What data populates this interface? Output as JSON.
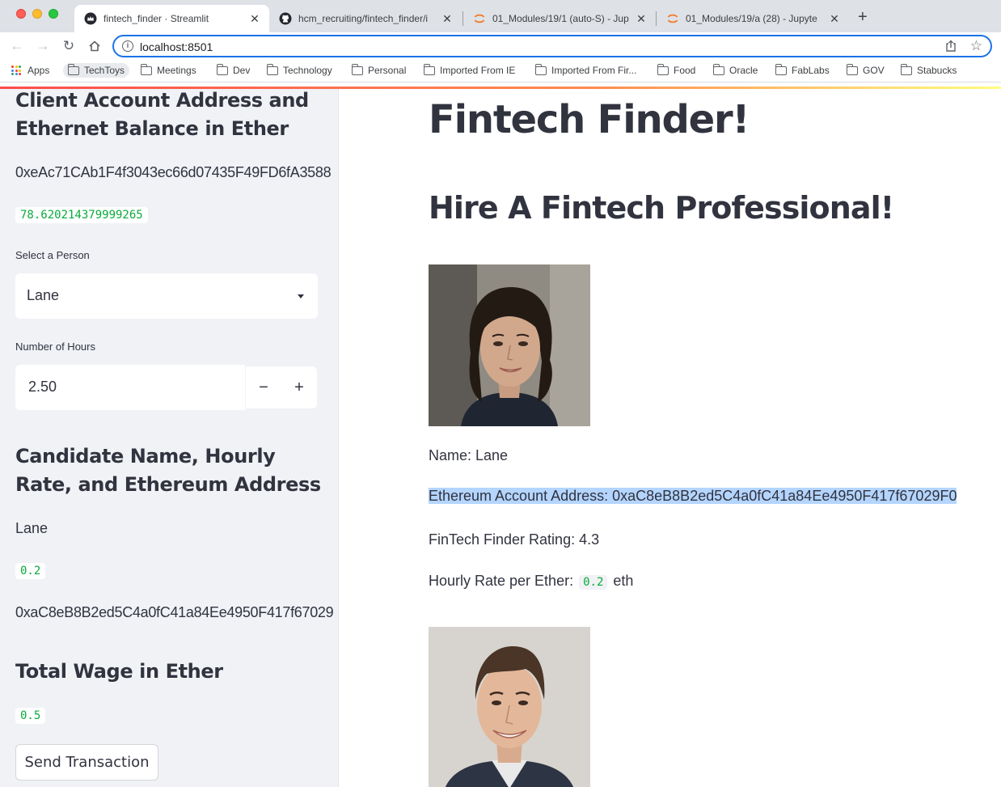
{
  "browser": {
    "tabs": [
      {
        "title": "fintech_finder · Streamlit",
        "active": true,
        "icon": "streamlit-crown-icon"
      },
      {
        "title": "hcm_recruiting/fintech_finder/i",
        "icon": "github-icon"
      },
      {
        "title": "01_Modules/19/1 (auto-S) - Jup",
        "icon": "jupyter-icon"
      },
      {
        "title": "01_Modules/19/a (28) - Jupyte",
        "icon": "jupyter-icon"
      }
    ],
    "url": "localhost:8501",
    "bookmarks": [
      "Apps",
      "TechToys",
      "Meetings",
      "Dev",
      "Technology",
      "Personal",
      "Imported From IE",
      "Imported From Fir...",
      "Food",
      "Oracle",
      "FabLabs",
      "GOV",
      "Stabucks"
    ]
  },
  "sidebar": {
    "client_header": "Client Account Address and Ethernet Balance in Ether",
    "client_address": "0xeAc71CAb1F4f3043ec66d07435F49FD6fA3588",
    "client_balance": "78.620214379999265",
    "select_person_label": "Select a Person",
    "selected_person": "Lane",
    "hours_label": "Number of Hours",
    "hours_value": "2.50",
    "minus_label": "−",
    "plus_label": "+",
    "candidate_header": "Candidate Name, Hourly Rate, and Ethereum Address",
    "candidate_name": "Lane",
    "candidate_rate": "0.2",
    "candidate_address": "0xaC8eB8B2ed5C4a0fC41a84Ee4950F417f67029",
    "total_wage_header": "Total Wage in Ether",
    "total_wage": "0.5",
    "send_button": "Send Transaction"
  },
  "main": {
    "title": "Fintech Finder!",
    "subtitle": "Hire A Fintech Professional!",
    "candidate": {
      "name_line": "Name: Lane",
      "address_line": "Ethereum Account Address: 0xaC8eB8B2ed5C4a0fC41a84Ee4950F417f67029F0",
      "rating_line": "FinTech Finder Rating: 4.3",
      "rate_prefix": "Hourly Rate per Ether:",
      "rate_value": "0.2",
      "rate_suffix": "eth"
    }
  },
  "colors": {
    "sidebar_bg": "#f0f2f6",
    "code_green": "#09ab3b",
    "text": "#31333f",
    "selection": "#b4d5fe",
    "omnibox_focus": "#1a73e8"
  }
}
